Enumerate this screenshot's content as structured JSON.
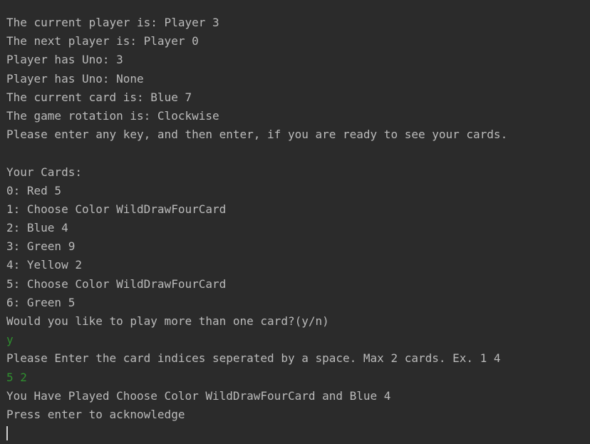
{
  "console": {
    "lines": [
      {
        "text": "The current player is: Player 3",
        "kind": "output"
      },
      {
        "text": "The next player is: Player 0",
        "kind": "output"
      },
      {
        "text": "Player has Uno: 3",
        "kind": "output"
      },
      {
        "text": "Player has Uno: None",
        "kind": "output"
      },
      {
        "text": "The current card is: Blue 7",
        "kind": "output"
      },
      {
        "text": "The game rotation is: Clockwise",
        "kind": "output"
      },
      {
        "text": "Please enter any key, and then enter, if you are ready to see your cards.",
        "kind": "output"
      },
      {
        "text": "",
        "kind": "blank"
      },
      {
        "text": "Your Cards:",
        "kind": "output"
      },
      {
        "text": "0: Red 5",
        "kind": "output"
      },
      {
        "text": "1: Choose Color WildDrawFourCard",
        "kind": "output"
      },
      {
        "text": "2: Blue 4",
        "kind": "output"
      },
      {
        "text": "3: Green 9",
        "kind": "output"
      },
      {
        "text": "4: Yellow 2",
        "kind": "output"
      },
      {
        "text": "5: Choose Color WildDrawFourCard",
        "kind": "output"
      },
      {
        "text": "6: Green 5",
        "kind": "output"
      },
      {
        "text": "Would you like to play more than one card?(y/n)",
        "kind": "output"
      },
      {
        "text": "y",
        "kind": "input"
      },
      {
        "text": "Please Enter the card indices seperated by a space. Max 2 cards. Ex. 1 4",
        "kind": "output"
      },
      {
        "text": "5 2",
        "kind": "input"
      },
      {
        "text": "You Have Played Choose Color WildDrawFourCard and Blue 4",
        "kind": "output"
      },
      {
        "text": "Press enter to acknowledge",
        "kind": "output"
      }
    ]
  },
  "colors": {
    "background": "#2b2b2b",
    "output_text": "#bbbbbb",
    "input_text": "#2f8f2f",
    "cursor": "#d0d0d0"
  }
}
